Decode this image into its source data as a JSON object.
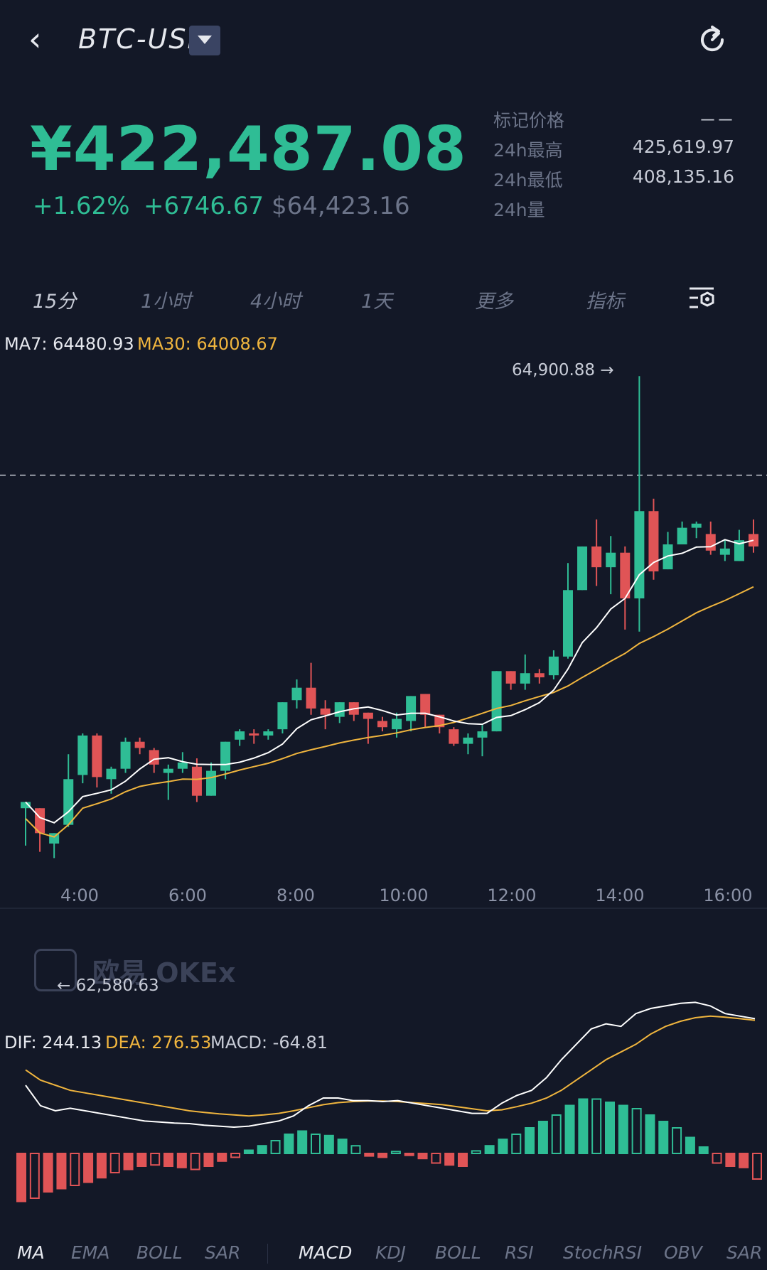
{
  "header": {
    "back_icon": "chevron-left-icon",
    "pair": "BTC-USD",
    "dropdown_icon": "caret-down-icon",
    "refresh_icon": "refresh-icon"
  },
  "ticker": {
    "price": "¥422,487.08",
    "change_pct": "+1.62%",
    "change_abs": "+6746.67",
    "usd_price": "$64,423.16",
    "stats": [
      {
        "label": "标记价格",
        "value": "－－"
      },
      {
        "label": "24h最高",
        "value": "425,619.97"
      },
      {
        "label": "24h最低",
        "value": "408,135.16"
      },
      {
        "label": "24h量",
        "value": ""
      }
    ]
  },
  "timeframes": [
    {
      "label": "15分",
      "active": true
    },
    {
      "label": "1小时",
      "active": false
    },
    {
      "label": "4小时",
      "active": false
    },
    {
      "label": "1天",
      "active": false
    },
    {
      "label": "更多",
      "active": false
    },
    {
      "label": "指标",
      "active": false
    }
  ],
  "settings_icon": "chart-settings-icon",
  "colors": {
    "up": "#2fbd95",
    "down": "#e05456",
    "ma7": "#ffffff",
    "ma30": "#f0b53e",
    "bg": "#131827"
  },
  "main_legend": {
    "ma7": "MA7: 64480.93",
    "ma30": "MA30: 64008.67"
  },
  "annotations": {
    "high": "64,900.88 →",
    "low": "← 62,580.63"
  },
  "watermark": "欧易 OKEx",
  "macd_legend": {
    "dif": "DIF: 244.13",
    "dea": "DEA: 276.53",
    "macd": "MACD: -64.81"
  },
  "bottom_nav": {
    "main": [
      "MA",
      "EMA",
      "BOLL",
      "SAR"
    ],
    "sub": [
      "MACD",
      "KDJ",
      "BOLL",
      "RSI",
      "StochRSI",
      "OBV",
      "SAR"
    ]
  },
  "chart_data": {
    "type": "candlestick",
    "x_ticks": [
      "4:00",
      "6:00",
      "8:00",
      "10:00",
      "12:00",
      "14:00",
      "16:00"
    ],
    "current_price": 64423.16,
    "candles": [
      [
        62820,
        62850,
        62640,
        62770
      ],
      [
        62820,
        62700,
        62610,
        62770
      ],
      [
        62650,
        62700,
        62580,
        62500
      ],
      [
        62740,
        62960,
        62730,
        63080
      ],
      [
        62980,
        63170,
        62940,
        63180
      ],
      [
        63170,
        62970,
        62920,
        63180
      ],
      [
        62960,
        63010,
        62890,
        63020
      ],
      [
        63010,
        63140,
        62990,
        63160
      ],
      [
        63140,
        63110,
        63080,
        63160
      ],
      [
        63100,
        63030,
        62990,
        63110
      ],
      [
        62990,
        63010,
        62860,
        63030
      ],
      [
        63010,
        63040,
        62990,
        63090
      ],
      [
        63020,
        62880,
        62850,
        63060
      ],
      [
        62880,
        63000,
        62880,
        63040
      ],
      [
        63000,
        63140,
        62960,
        63140
      ],
      [
        63150,
        63190,
        63120,
        63200
      ],
      [
        63180,
        63170,
        63130,
        63200
      ],
      [
        63170,
        63190,
        63150,
        63200
      ],
      [
        63200,
        63330,
        63180,
        63330
      ],
      [
        63340,
        63400,
        63300,
        63440
      ],
      [
        63400,
        63300,
        63270,
        63520
      ],
      [
        63300,
        63270,
        63200,
        63340
      ],
      [
        63260,
        63330,
        63230,
        63330
      ],
      [
        63330,
        63270,
        63240,
        63300
      ],
      [
        63280,
        63250,
        63130,
        63280
      ],
      [
        63240,
        63210,
        63190,
        63260
      ],
      [
        63200,
        63250,
        63160,
        63280
      ],
      [
        63240,
        63360,
        63190,
        63360
      ],
      [
        63370,
        63270,
        63210,
        63370
      ],
      [
        63270,
        63210,
        63180,
        63270
      ],
      [
        63200,
        63130,
        63120,
        63210
      ],
      [
        63130,
        63160,
        63080,
        63180
      ],
      [
        63160,
        63190,
        63070,
        63220
      ],
      [
        63190,
        63480,
        63190,
        63480
      ],
      [
        63480,
        63420,
        63390,
        63480
      ],
      [
        63420,
        63470,
        63390,
        63560
      ],
      [
        63470,
        63450,
        63420,
        63490
      ],
      [
        63460,
        63550,
        63440,
        63580
      ],
      [
        63550,
        63870,
        63540,
        64000
      ],
      [
        63870,
        64080,
        63880,
        64080
      ],
      [
        64080,
        63980,
        63890,
        64210
      ],
      [
        63980,
        64050,
        63850,
        64130
      ],
      [
        64050,
        63830,
        63680,
        64080
      ],
      [
        63830,
        64250,
        63670,
        64900
      ],
      [
        64250,
        63960,
        63920,
        64310
      ],
      [
        63970,
        64090,
        64020,
        64150
      ],
      [
        64090,
        64170,
        64100,
        64200
      ],
      [
        64170,
        64190,
        64120,
        64200
      ],
      [
        64140,
        64060,
        64040,
        64200
      ],
      [
        64040,
        64070,
        64010,
        64110
      ],
      [
        64010,
        64110,
        64010,
        64160
      ],
      [
        64140,
        64080,
        64050,
        64210
      ]
    ],
    "ma7": "white line",
    "ma30": "yellow line",
    "macd": {
      "dif": [
        150,
        110,
        100,
        105,
        100,
        95,
        90,
        85,
        80,
        78,
        76,
        75,
        72,
        70,
        68,
        70,
        75,
        80,
        90,
        110,
        125,
        125,
        120,
        120,
        118,
        120,
        115,
        110,
        105,
        100,
        95,
        95,
        115,
        130,
        140,
        165,
        200,
        230,
        260,
        270,
        265,
        290,
        300,
        305,
        310,
        312,
        305,
        290,
        285,
        280
      ],
      "dea": [
        180,
        160,
        150,
        140,
        135,
        130,
        125,
        120,
        115,
        110,
        105,
        100,
        97,
        94,
        92,
        90,
        92,
        95,
        100,
        106,
        112,
        116,
        118,
        119,
        119,
        118,
        116,
        114,
        112,
        108,
        104,
        100,
        102,
        108,
        115,
        125,
        140,
        160,
        180,
        200,
        215,
        230,
        250,
        265,
        275,
        282,
        285,
        283,
        280,
        277
      ],
      "hist": [
        -75,
        -70,
        -60,
        -55,
        -50,
        -45,
        -38,
        -30,
        -25,
        -20,
        -18,
        -20,
        -22,
        -25,
        -20,
        -12,
        -6,
        5,
        12,
        20,
        30,
        35,
        30,
        28,
        22,
        12,
        -4,
        -6,
        3,
        -3,
        -8,
        -15,
        -18,
        -20,
        4,
        12,
        22,
        30,
        40,
        50,
        60,
        75,
        85,
        85,
        80,
        75,
        70,
        60,
        50,
        40,
        25,
        10,
        -15,
        -20,
        -22,
        -40
      ]
    }
  }
}
